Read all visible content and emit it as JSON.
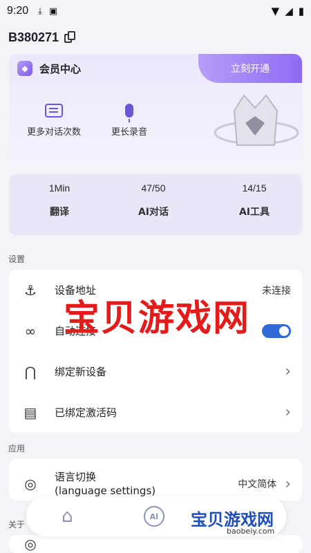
{
  "status": {
    "time": "9:20"
  },
  "account": {
    "id": "B380271"
  },
  "vip": {
    "title": "会员中心",
    "open_button": "立刻开通",
    "perks": [
      "更多对话次数",
      "更长录音"
    ]
  },
  "stats": [
    {
      "value": "1Min",
      "label": "翻译"
    },
    {
      "value": "47/50",
      "label": "AI对话"
    },
    {
      "value": "14/15",
      "label": "AI工具"
    }
  ],
  "settings": {
    "section": "设置",
    "device_address": {
      "label": "设备地址",
      "value": "未连接"
    },
    "auto_connect": {
      "label": "自动连接",
      "enabled": true
    },
    "bind_device": {
      "label": "绑定新设备"
    },
    "bound_codes": {
      "label": "已绑定激活码"
    }
  },
  "apps": {
    "section": "应用",
    "language": {
      "label": "语言切换",
      "sublabel": "(language settings)",
      "value": "中文简体"
    }
  },
  "about": {
    "section": "关于"
  },
  "watermark": {
    "text": "宝贝游戏网",
    "logo": "宝贝游戏网",
    "url": "baobeiy.com"
  },
  "colors": {
    "accent": "#6b57d6",
    "toggle": "#2f6bd6",
    "watermark": "#e31b1b"
  }
}
